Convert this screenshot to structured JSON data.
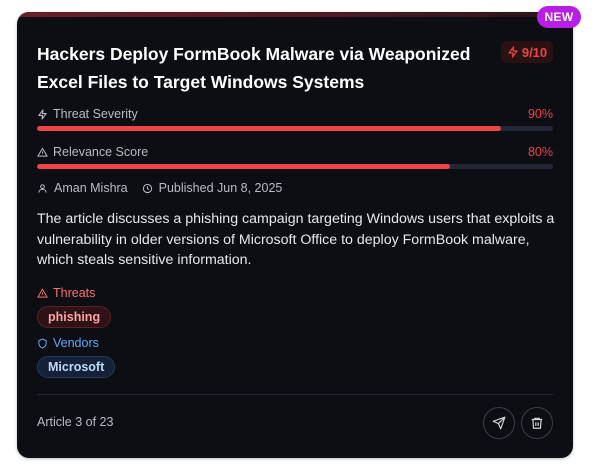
{
  "badge": {
    "label": "NEW"
  },
  "article": {
    "title": "Hackers Deploy FormBook Malware via Weaponized Excel Files to Target Windows Systems",
    "score": "9/10",
    "author": "Aman Mishra",
    "published": "Published Jun 8, 2025",
    "summary": "The article discusses a phishing campaign targeting Windows users that exploits a vulnerability in older versions of Microsoft Office to deploy FormBook malware, which steals sensitive information."
  },
  "metrics": [
    {
      "label": "Threat Severity",
      "percent_label": "90%",
      "value": 90
    },
    {
      "label": "Relevance Score",
      "percent_label": "80%",
      "value": 80
    }
  ],
  "threats": {
    "label": "Threats",
    "tags": [
      "phishing"
    ]
  },
  "vendors": {
    "label": "Vendors",
    "tags": [
      "Microsoft"
    ]
  },
  "footer": {
    "position": "Article 3 of 23"
  },
  "colors": {
    "accent_red": "#ef4444",
    "new_badge": "#b91ee6",
    "vendor_blue": "#60a5fa",
    "card_bg": "#0c0e14"
  },
  "icons": {
    "score": "lightning-icon",
    "severity": "lightning-icon",
    "relevance": "warning-triangle-icon",
    "author": "user-icon",
    "published": "clock-icon",
    "threats": "warning-triangle-icon",
    "vendors": "shield-icon",
    "send": "send-icon",
    "delete": "trash-icon"
  }
}
